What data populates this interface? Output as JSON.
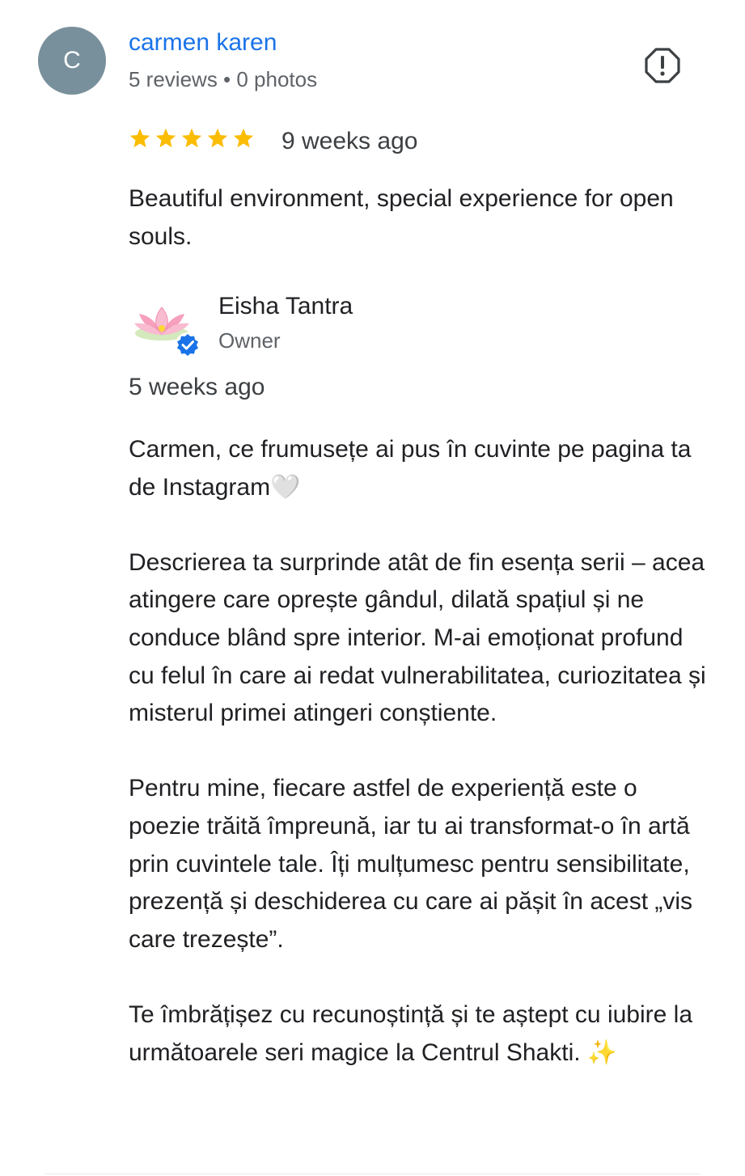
{
  "review": {
    "reviewer": {
      "initial": "C",
      "name": "carmen karen",
      "meta": "5 reviews • 0 photos",
      "avatar_color": "#78909c"
    },
    "rating": 5,
    "rating_max": 5,
    "date": "9 weeks ago",
    "text": "Beautiful environment, special experience for open souls.",
    "report_icon": "report-flag-icon"
  },
  "owner_response": {
    "name": "Eisha Tantra",
    "role": "Owner",
    "logo_icon": "lotus-flower-icon",
    "verified_icon": "verified-badge-icon",
    "date": "5 weeks ago",
    "paragraphs": [
      "Carmen, ce frumusețe ai pus în cuvinte pe pagina ta de Instagram🤍",
      "Descrierea ta surprinde atât de fin esența serii – acea atingere care oprește gândul, dilată spațiul și ne conduce blând spre interior. M-ai emoționat profund cu felul în care ai redat vulnerabilitatea, curiozitatea și misterul primei atingeri conștiente.",
      "Pentru mine, fiecare astfel de experiență este o poezie trăită împreună, iar tu ai transformat-o în artă prin cuvintele tale. Îți mulțumesc pentru sensibilitate, prezență și deschiderea cu care ai pășit în acest „vis care trezește”.",
      "Te îmbrățișez cu recunoștință și te aștept cu iubire la următoarele seri magice la Centrul Shakti. ✨"
    ]
  },
  "colors": {
    "link_blue": "#1a73e8",
    "star_yellow": "#fbbc04",
    "secondary_text": "#5f6368",
    "verified_blue": "#1a73e8"
  }
}
